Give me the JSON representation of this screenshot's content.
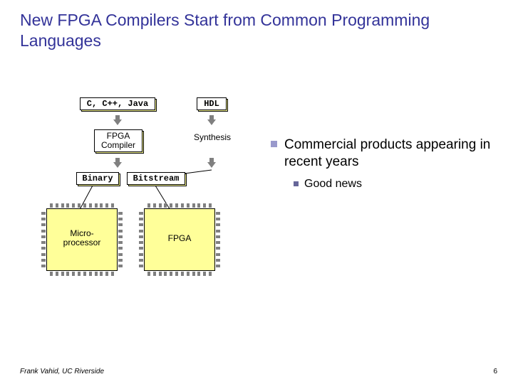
{
  "title": "New FPGA Compilers Start from Common Programming Languages",
  "diagram": {
    "source_languages": "C, C++, Java",
    "hdl": "HDL",
    "fpga_compiler": "FPGA\nCompiler",
    "synthesis": "Synthesis",
    "binary": "Binary",
    "bitstream": "Bitstream",
    "microprocessor": "Micro-\nprocessor",
    "fpga_chip": "FPGA"
  },
  "bullets": {
    "main": "Commercial products appearing in recent years",
    "sub": "Good news"
  },
  "footer": "Frank Vahid, UC Riverside",
  "page_number": "6"
}
